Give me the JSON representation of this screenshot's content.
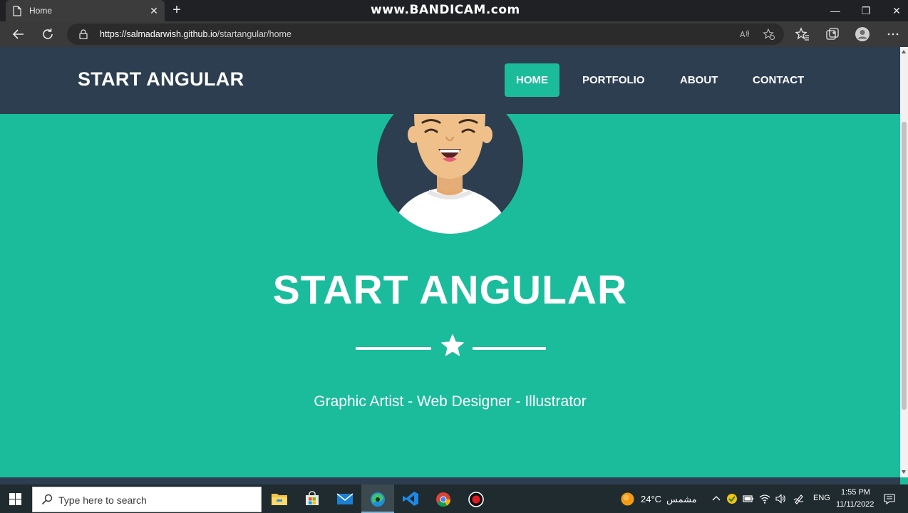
{
  "browser": {
    "tab_title": "Home",
    "tab_close": "✕",
    "new_tab": "+",
    "watermark": "www.BANDICAM.com",
    "url_host": "https://salmadarwish.github.io",
    "url_path": "/startangular/home",
    "window_minimize": "—",
    "window_restore": "❐",
    "window_close": "✕"
  },
  "navbar": {
    "brand": "START ANGULAR",
    "links": [
      "HOME",
      "PORTFOLIO",
      "ABOUT",
      "CONTACT"
    ],
    "active": "HOME"
  },
  "hero": {
    "title": "START ANGULAR",
    "subtitle": "Graphic Artist - Web Designer - Illustrator"
  },
  "taskbar": {
    "search_placeholder": "Type here to search",
    "weather_temp": "24°C",
    "weather_text": "مشمس",
    "language": "ENG",
    "time": "1:55 PM",
    "date": "11/11/2022"
  },
  "colors": {
    "primary": "#1abc9c",
    "navbar": "#2c3e50",
    "avatar_bg": "#2c3e50",
    "skin": "#f0c08a"
  }
}
